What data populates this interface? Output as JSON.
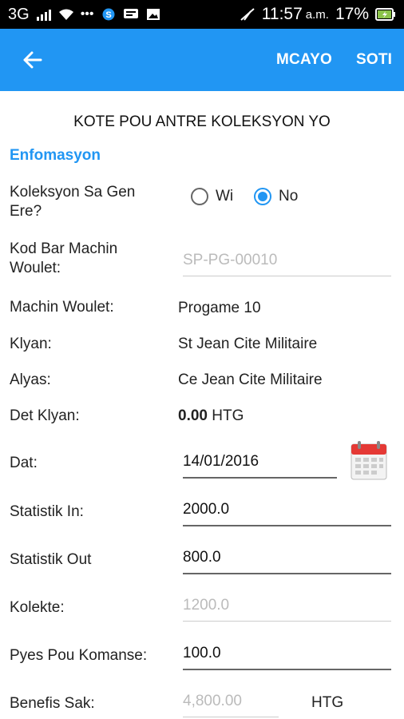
{
  "status_bar": {
    "network": "3G",
    "time": "11:57",
    "ampm": "a.m.",
    "battery": "17%"
  },
  "app_bar": {
    "back_icon": "arrow-left-icon",
    "action_1": "MCAYO",
    "action_2": "SOTI"
  },
  "page": {
    "title": "KOTE POU ANTRE KOLEKSYON YO",
    "section": "Enfomasyon"
  },
  "form": {
    "collection_generated": {
      "label": "Koleksyon Sa Gen Ere?",
      "options": [
        "Wi",
        "No"
      ],
      "selected": "No"
    },
    "barcode": {
      "label": "Kod Bar Machin Woulet:",
      "placeholder": "SP-PG-00010"
    },
    "machine": {
      "label": "Machin Woulet:",
      "value": "Progame 10"
    },
    "client": {
      "label": "Klyan:",
      "value": "St Jean Cite Militaire"
    },
    "alias": {
      "label": "Alyas:",
      "value": "Ce Jean Cite Militaire"
    },
    "debt": {
      "label": "Det Klyan:",
      "amount": "0.00",
      "currency": "HTG"
    },
    "date": {
      "label": "Dat:",
      "value": "14/01/2016"
    },
    "stat_in": {
      "label": "Statistik In:",
      "value": "2000.0"
    },
    "stat_out": {
      "label": "Statistik Out",
      "value": "800.0"
    },
    "collected": {
      "label": "Kolekte:",
      "value": "1200.0"
    },
    "start_pieces": {
      "label": "Pyes Pou Komanse:",
      "value": "100.0"
    },
    "profit": {
      "label": "Benefis Sak:",
      "value": "4,800.00",
      "currency": "HTG"
    }
  },
  "colors": {
    "primary": "#2196F3",
    "calendar_red": "#E53935"
  }
}
